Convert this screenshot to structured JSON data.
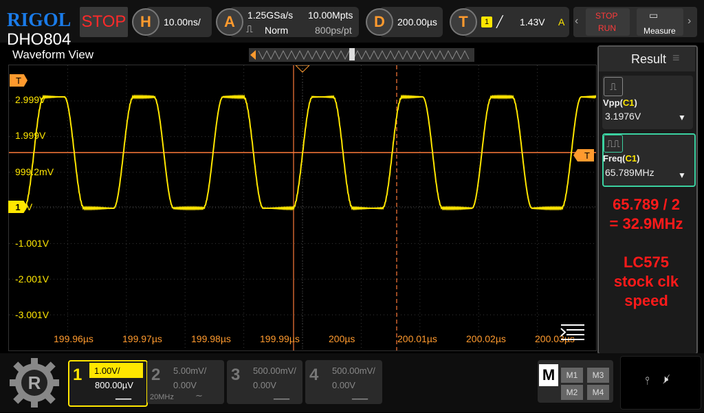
{
  "brand": "RIGOL",
  "model": "DHO804",
  "run_state": "STOP",
  "horizontal": {
    "letter": "H",
    "scale": "10.00ns/"
  },
  "acquire": {
    "letter": "A",
    "rate": "1.25GSa/s",
    "mode": "Norm",
    "depth": "10.00Mpts",
    "pts": "800ps/pt"
  },
  "delay": {
    "letter": "D",
    "value": "200.00µs"
  },
  "trigger": {
    "letter": "T",
    "channel": "1",
    "level": "1.43V",
    "mode": "A"
  },
  "stoprun": {
    "stop": "STOP",
    "run": "RUN"
  },
  "measure_label": "Measure",
  "waveform_title": "Waveform View",
  "y_labels": [
    "2.999V",
    "1.999V",
    "999.2mV",
    "0µV",
    "-1.001V",
    "-2.001V",
    "-3.001V"
  ],
  "x_labels": [
    "199.96µs",
    "199.97µs",
    "199.98µs",
    "199.99µs",
    "200µs",
    "200.01µs",
    "200.02µs",
    "200.03µs",
    "200.04µs"
  ],
  "markers": {
    "trigger": "T",
    "ch1": "1",
    "level": "T"
  },
  "result": {
    "title": "Result",
    "m1": {
      "name": "Vpp",
      "src": "C1",
      "value": "3.1976V"
    },
    "m2": {
      "name": "Freq",
      "src": "C1",
      "value": "65.789MHz"
    },
    "note1": "65.789 / 2\n= 32.9MHz",
    "note2": "LC575\nstock clk\nspeed"
  },
  "channels": [
    {
      "num": "1",
      "scale": "1.00V/",
      "offset": "800.00µV",
      "extra": ""
    },
    {
      "num": "2",
      "scale": "5.00mV/",
      "offset": "0.00V",
      "extra": "20MHz"
    },
    {
      "num": "3",
      "scale": "500.00mV/",
      "offset": "0.00V",
      "extra": ""
    },
    {
      "num": "4",
      "scale": "500.00mV/",
      "offset": "0.00V",
      "extra": ""
    }
  ],
  "math": {
    "label": "M",
    "items": [
      "M1",
      "M3",
      "M2",
      "M4"
    ]
  },
  "colors": {
    "ch1": "#ffe600",
    "accent": "#ff9a2e",
    "cursor": "#ff7a3a",
    "alert": "#ff1a1a"
  }
}
